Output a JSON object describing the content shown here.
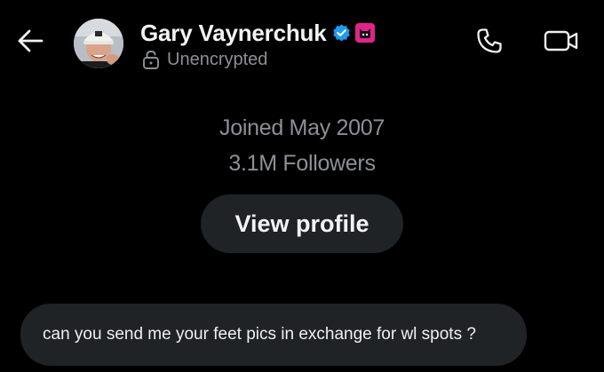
{
  "header": {
    "contact_name": "Gary Vaynerchuk",
    "encryption_status": "Unencrypted",
    "icons": {
      "back": "arrow-left-icon",
      "avatar": "avatar",
      "verified": "verified-badge-icon",
      "affiliate": "affiliate-badge-icon",
      "lock": "unlocked-padlock-icon",
      "call": "phone-icon",
      "video": "video-camera-icon"
    }
  },
  "profile": {
    "joined": "Joined May 2007",
    "followers": "3.1M Followers",
    "view_profile_label": "View profile"
  },
  "messages": [
    {
      "text": "can you send me your feet pics in exchange for wl spots ?"
    }
  ],
  "colors": {
    "background": "#000000",
    "bubble": "#202326",
    "verified_blue": "#1d9bf0",
    "affiliate_pink": "#e0248b",
    "secondary_text": "#8b9096"
  }
}
